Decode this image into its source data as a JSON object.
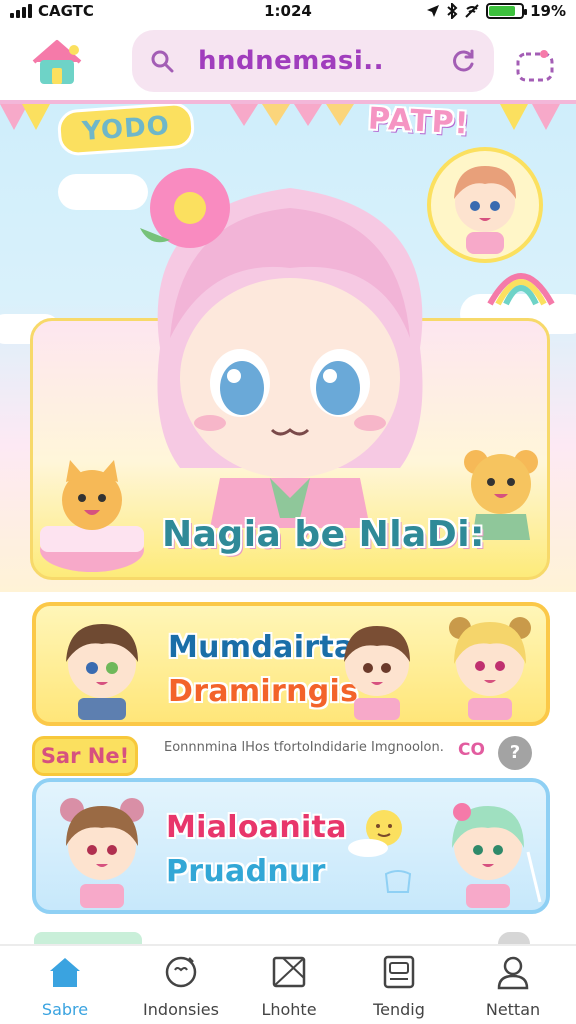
{
  "status_bar": {
    "carrier": "CAGTC",
    "time": "1:024",
    "battery": "19%"
  },
  "header": {
    "search_text": "hndnemasi..",
    "icons": [
      "home-icon",
      "search-icon",
      "refresh-icon",
      "menu-icon"
    ]
  },
  "hero": {
    "sticker_left": "YODO",
    "sticker_right": "PATP!",
    "title": "Nagia be NlaDi:"
  },
  "cards": [
    {
      "title": "Mumdairta",
      "subtitle": "Dramirngis"
    },
    {
      "title": "Mialoanita",
      "subtitle": "Pruadnur"
    }
  ],
  "notice": {
    "badge": "Sar Ne!",
    "text": "Eonnnmina lHos tfortoIndidarie Imgnoolon.",
    "count": "CO"
  },
  "tabs": [
    {
      "label": "Sabre",
      "icon": "home-icon",
      "active": true
    },
    {
      "label": "Indonsies",
      "icon": "heart-bubble-icon",
      "active": false
    },
    {
      "label": "Lhohte",
      "icon": "envelope-icon",
      "active": false
    },
    {
      "label": "Tendig",
      "icon": "tv-icon",
      "active": false
    },
    {
      "label": "Nettan",
      "icon": "profile-icon",
      "active": false
    }
  ],
  "colors": {
    "accent": "#3aa3e0",
    "search_bg": "#f6e4f1",
    "card_yellow": "#ffe679",
    "card_blue": "#c7e8fb"
  }
}
